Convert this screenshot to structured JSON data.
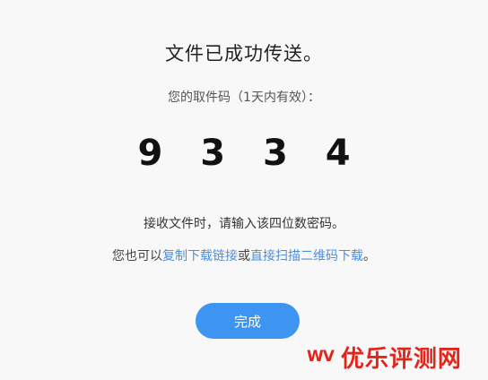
{
  "dialog": {
    "title": "文件已成功传送。",
    "subtitle": "您的取件码（1天内有效）：",
    "code": "9 3 3 4",
    "instruction": "接收文件时，请输入该四位数密码。",
    "alt": {
      "prefix": "您也可以",
      "copy_link": "复制下载链接",
      "middle": "或",
      "scan_qr": "直接扫描二维码下载",
      "suffix": "。"
    },
    "done_label": "完成"
  },
  "watermark": {
    "logo": "WV",
    "text": "优乐评测网"
  },
  "colors": {
    "link": "#4a8fdf",
    "button": "#3d95f1",
    "watermark": "#e1251b"
  }
}
